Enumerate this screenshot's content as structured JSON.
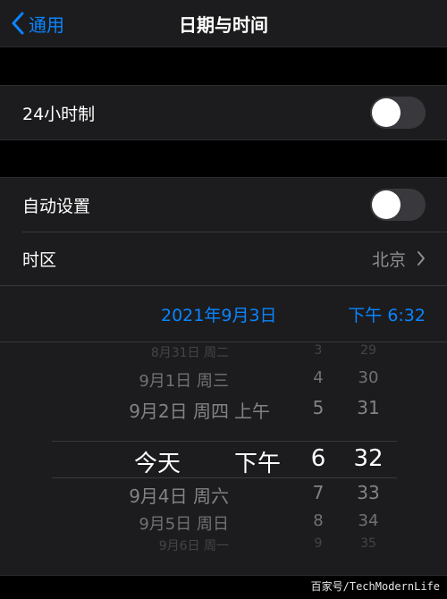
{
  "navbar": {
    "back_label": "通用",
    "title": "日期与时间"
  },
  "hour24": {
    "label": "24小时制",
    "on": false
  },
  "auto": {
    "label": "自动设置",
    "on": false
  },
  "timezone": {
    "label": "时区",
    "value": "北京"
  },
  "summary": {
    "date": "2021年9月3日",
    "time": "下午 6:32"
  },
  "picker": {
    "dates": [
      "8月31日 周二",
      "9月1日 周三",
      "9月2日 周四",
      "今天",
      "9月4日 周六",
      "9月5日 周日",
      "9月6日 周一"
    ],
    "ampm": [
      "上午",
      "下午"
    ],
    "hours": [
      "3",
      "4",
      "5",
      "6",
      "7",
      "8",
      "9"
    ],
    "minutes": [
      "29",
      "30",
      "31",
      "32",
      "33",
      "34",
      "35"
    ]
  },
  "watermark": "百家号/TechModernLife",
  "colors": {
    "accent": "#0a84ff",
    "secondary": "#8e8e93",
    "cell": "#1c1c1e"
  }
}
